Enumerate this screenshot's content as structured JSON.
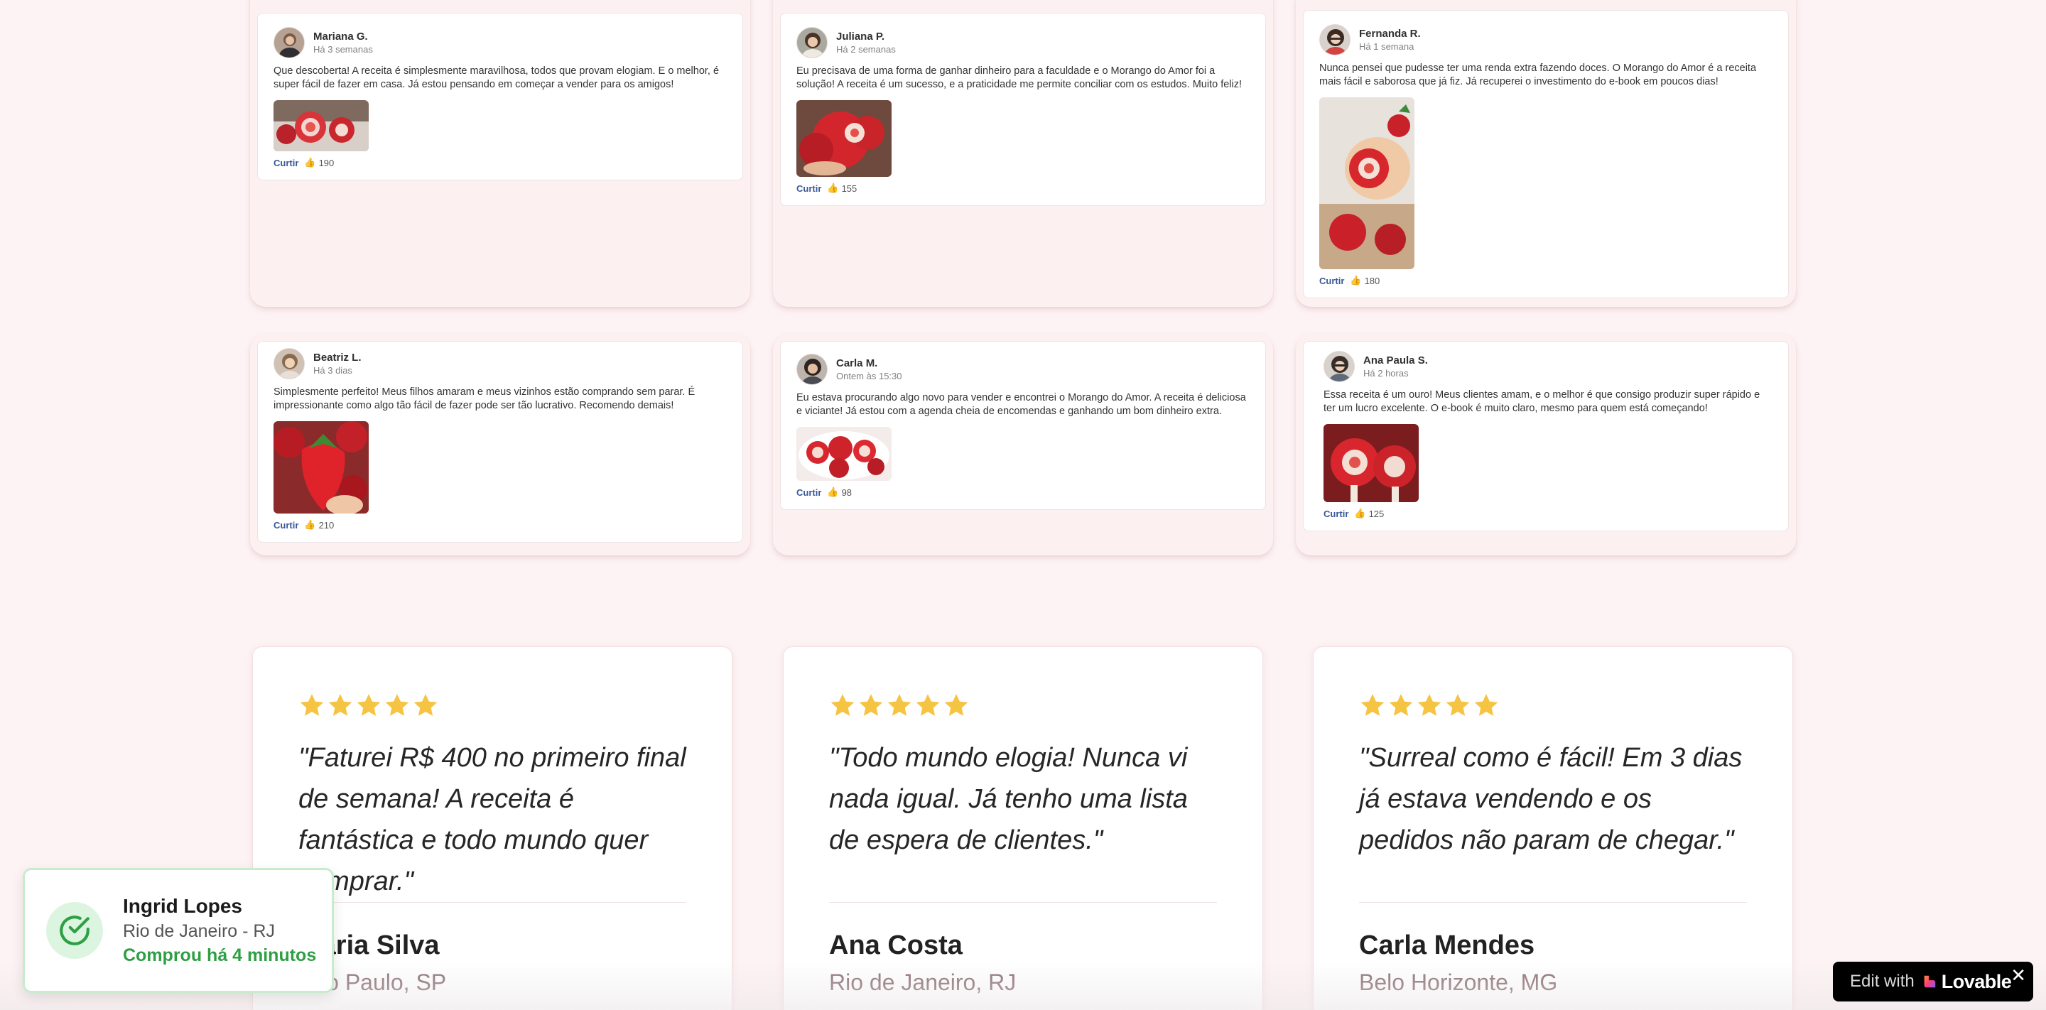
{
  "posts": [
    {
      "name": "Mariana G.",
      "time": "Há 3 semanas",
      "text": "Que descoberta! A receita é simplesmente maravilhosa, todos que provam elogiam. E o melhor, é super fácil de fazer em casa. Já estou pensando em começar a vender para os amigos!",
      "like_label": "Curtir",
      "likes": "190"
    },
    {
      "name": "Juliana P.",
      "time": "Há 2 semanas",
      "text": "Eu precisava de uma forma de ganhar dinheiro para a faculdade e o Morango do Amor foi a solução! A receita é um sucesso, e a praticidade me permite conciliar com os estudos. Muito feliz!",
      "like_label": "Curtir",
      "likes": "155"
    },
    {
      "name": "Fernanda R.",
      "time": "Há 1 semana",
      "text": "Nunca pensei que pudesse ter uma renda extra fazendo doces. O Morango do Amor é a receita mais fácil e saborosa que já fiz. Já recuperei o investimento do e-book em poucos dias!",
      "like_label": "Curtir",
      "likes": "180"
    },
    {
      "name": "Beatriz L.",
      "time": "Há 3 dias",
      "text": "Simplesmente perfeito! Meus filhos amaram e meus vizinhos estão comprando sem parar. É impressionante como algo tão fácil de fazer pode ser tão lucrativo. Recomendo demais!",
      "like_label": "Curtir",
      "likes": "210"
    },
    {
      "name": "Carla M.",
      "time": "Ontem às 15:30",
      "text": "Eu estava procurando algo novo para vender e encontrei o Morango do Amor. A receita é deliciosa e viciante! Já estou com a agenda cheia de encomendas e ganhando um bom dinheiro extra.",
      "like_label": "Curtir",
      "likes": "98"
    },
    {
      "name": "Ana Paula S.",
      "time": "Há 2 horas",
      "text": "Essa receita é um ouro! Meus clientes amam, e o melhor é que consigo produzir super rápido e ter um lucro excelente. O e-book é muito claro, mesmo para quem está começando!",
      "like_label": "Curtir",
      "likes": "125"
    }
  ],
  "testimonials": [
    {
      "quote": "\"Faturei R$ 400 no primeiro final de semana! A receita é fantástica e todo mundo quer comprar.\"",
      "name": "Maria Silva",
      "location": "São Paulo, SP",
      "stars": 5
    },
    {
      "quote": "\"Todo mundo elogia! Nunca vi nada igual. Já tenho uma lista de espera de clientes.\"",
      "name": "Ana Costa",
      "location": "Rio de Janeiro, RJ",
      "stars": 5
    },
    {
      "quote": "\"Surreal como é fácil! Em 3 dias já estava vendendo e os pedidos não param de chegar.\"",
      "name": "Carla Mendes",
      "location": "Belo Horizonte, MG",
      "stars": 5
    }
  ],
  "toast": {
    "name": "Ingrid Lopes",
    "city": "Rio de Janeiro - RJ",
    "time": "Comprou há 4 minutos"
  },
  "lovable": {
    "edit_label": "Edit with",
    "brand": "Lovable",
    "close": "✕"
  },
  "colors": {
    "star": "#f6c443",
    "like_link": "#3b5998",
    "toast_accent": "#2ea043",
    "strawberry": "#d92b2f"
  },
  "icons": {
    "like": "thumbs-up-icon",
    "toast": "check-circle-icon",
    "star": "star-icon",
    "close": "close-icon"
  }
}
